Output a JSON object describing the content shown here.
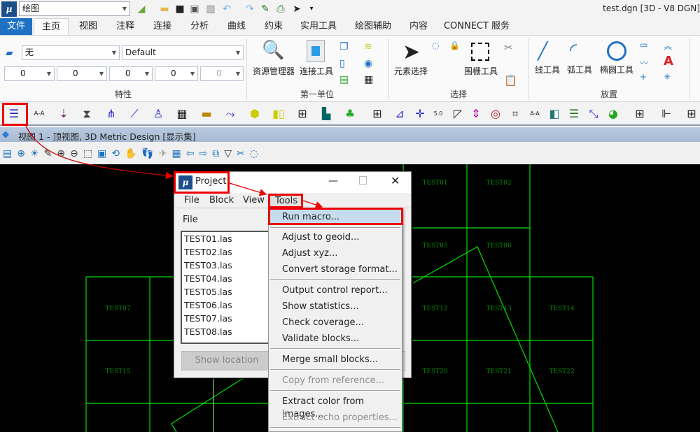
{
  "window": {
    "title": "test.dgn [3D - V8 DGN]",
    "workflow": "绘图"
  },
  "quick_access": [
    "view-display-icon",
    "open-icon",
    "save-icon",
    "save-settings-icon",
    "compress-icon",
    "undo-icon",
    "redo-icon",
    "pin-icon",
    "print-icon",
    "select-icon",
    "customize-icon"
  ],
  "tabs": [
    "文件",
    "主页",
    "视图",
    "注释",
    "连接",
    "分析",
    "曲线",
    "约束",
    "实用工具",
    "绘图辅助",
    "内容",
    "CONNECT 服务"
  ],
  "active_tab": "主页",
  "ribbon": {
    "attributes": {
      "level": "无",
      "style": "Default",
      "color": "0",
      "linestyle": "0",
      "weight": "0",
      "transparency": "0",
      "priority": "0",
      "label": "特性"
    },
    "primary": {
      "explorer": "资源管理器",
      "attach": "连接工具",
      "label": "第一单位"
    },
    "selection": {
      "element_select": "元素选择",
      "fence": "围栅工具",
      "label": "选择"
    },
    "placement": {
      "line": "线工具",
      "arc": "弧工具",
      "ellipse": "椭圆工具",
      "label": "放置"
    }
  },
  "view": {
    "title": "视图 1 - 顶视图, 3D Metric Design [显示集]"
  },
  "grid_labels": {
    "t01": "TEST01",
    "t02": "TEST02",
    "t05": "TEST05",
    "t06": "TEST06",
    "t07": "TEST07",
    "t12": "TEST12",
    "t13": "TEST13",
    "t14": "TEST14",
    "t15": "TEST15",
    "t20": "TEST20",
    "t21": "TEST21",
    "t22": "TEST22"
  },
  "dialog": {
    "title": "Project:",
    "menu": [
      "File",
      "Block",
      "View",
      "Tools"
    ],
    "list_header": "File",
    "files": [
      "TEST01.las",
      "TEST02.las",
      "TEST03.las",
      "TEST04.las",
      "TEST05.las",
      "TEST06.las",
      "TEST07.las",
      "TEST08.las"
    ],
    "show_location": "Show location"
  },
  "tools_menu": [
    {
      "label": "Run macro...",
      "highlighted": true
    },
    {
      "label": "Adjust to geoid..."
    },
    {
      "label": "Adjust xyz..."
    },
    {
      "label": "Convert storage format..."
    },
    {
      "label": "Output control report..."
    },
    {
      "label": "Show statistics..."
    },
    {
      "label": "Check coverage..."
    },
    {
      "label": "Validate blocks..."
    },
    {
      "label": "Merge small blocks..."
    },
    {
      "label": "Copy from reference...",
      "disabled": true
    },
    {
      "label": "Extract color from images..."
    },
    {
      "label": "Extract echo properties...",
      "disabled": true
    }
  ],
  "colors": {
    "accent": "#1f72c3",
    "grid": "#00ff00",
    "annotation": "#e00000",
    "menu_highlight": "#c5dcef"
  }
}
